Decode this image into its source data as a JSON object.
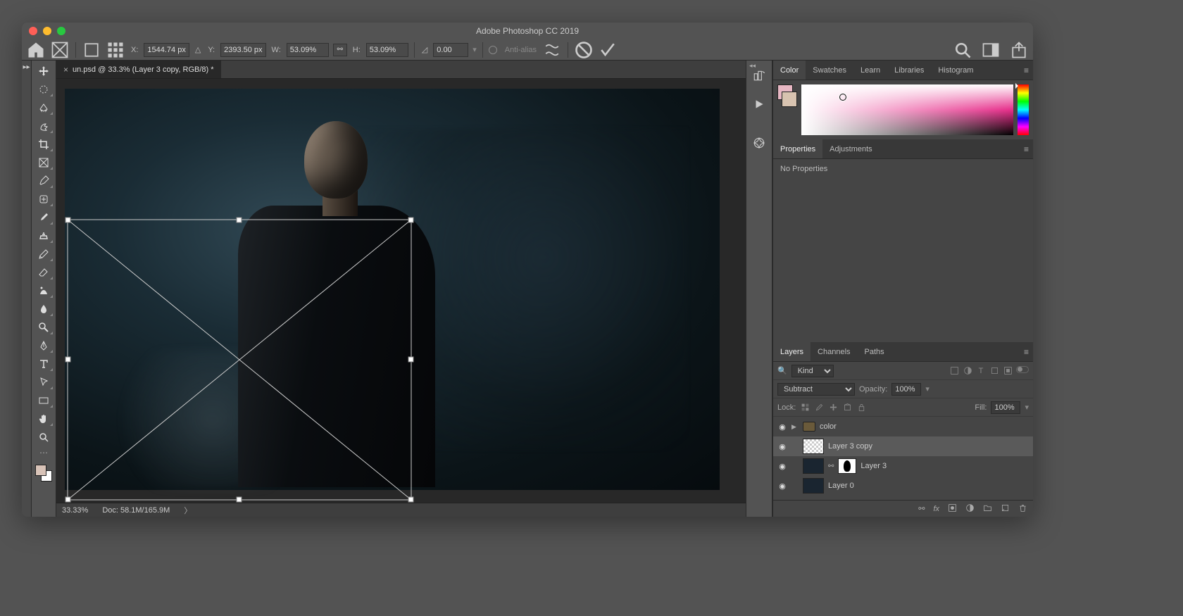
{
  "app": {
    "title": "Adobe Photoshop CC 2019"
  },
  "optionbar": {
    "x_label": "X:",
    "x_value": "1544.74 px",
    "y_label": "Y:",
    "y_value": "2393.50 px",
    "w_label": "W:",
    "w_value": "53.09%",
    "h_label": "H:",
    "h_value": "53.09%",
    "angle_value": "0.00",
    "interp_label": "Anti-alias"
  },
  "document": {
    "tab_title": "un.psd @ 33.3% (Layer 3 copy, RGB/8) *",
    "zoom": "33.33%",
    "doc_size": "Doc: 58.1M/165.9M"
  },
  "color_panel": {
    "tabs": [
      "Color",
      "Swatches",
      "Learn",
      "Libraries",
      "Histogram"
    ],
    "active": 0
  },
  "properties_panel": {
    "tabs": [
      "Properties",
      "Adjustments"
    ],
    "active": 0,
    "empty_text": "No Properties"
  },
  "layers_panel": {
    "tabs": [
      "Layers",
      "Channels",
      "Paths"
    ],
    "active": 0,
    "kind_placeholder": "Kind",
    "blend_mode": "Subtract",
    "opacity_label": "Opacity:",
    "opacity_value": "100%",
    "lock_label": "Lock:",
    "fill_label": "Fill:",
    "fill_value": "100%",
    "layers": [
      {
        "name": "color",
        "type": "group",
        "visible": true,
        "selected": false
      },
      {
        "name": "Layer 3 copy",
        "type": "layer",
        "visible": true,
        "selected": true
      },
      {
        "name": "Layer 3",
        "type": "masked",
        "visible": true,
        "selected": false
      },
      {
        "name": "Layer 0",
        "type": "layer",
        "visible": true,
        "selected": false
      }
    ]
  }
}
